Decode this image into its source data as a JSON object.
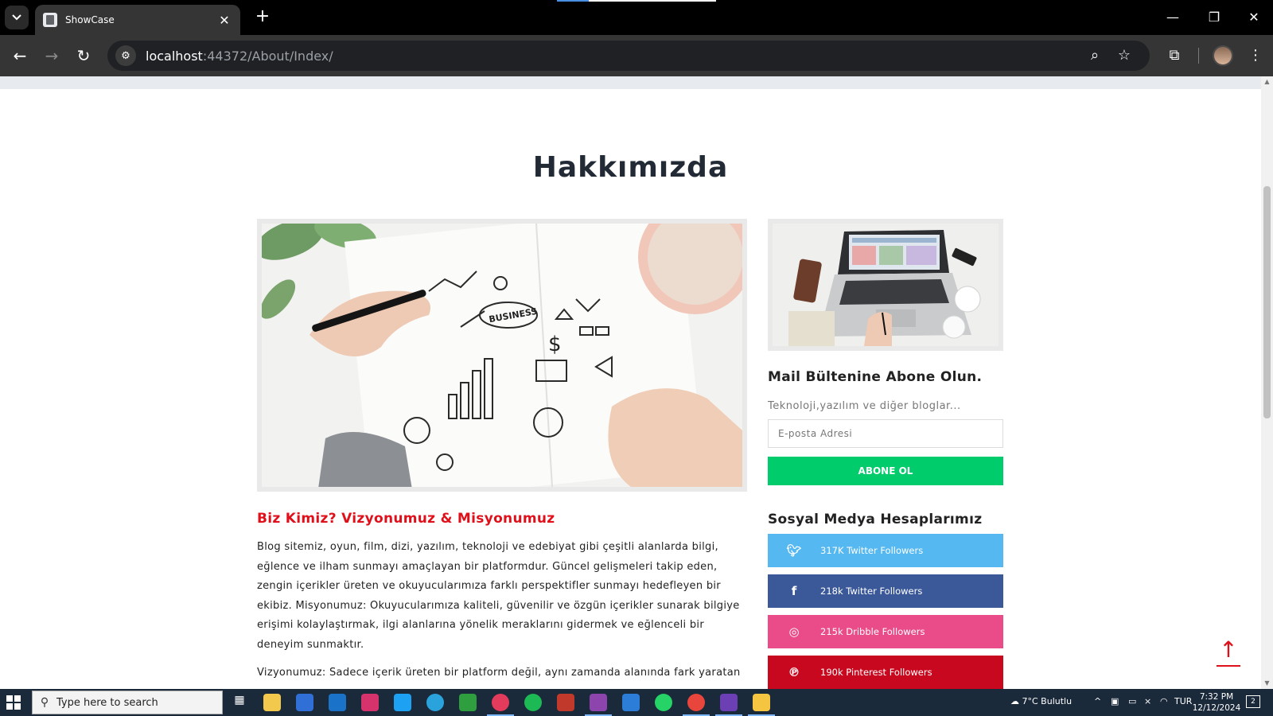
{
  "browser": {
    "tab_title": "ShowCase",
    "url_host": "localhost",
    "url_rest": ":44372/About/Index/"
  },
  "page": {
    "title": "Hakkımızda",
    "section_heading": "Biz Kimiz? Vizyonumuz & Misyonumuz",
    "paragraph_1": "Blog sitemiz, oyun, film, dizi, yazılım, teknoloji ve edebiyat gibi çeşitli alanlarda bilgi, eğlence ve ilham sunmayı amaçlayan bir platformdur. Güncel gelişmeleri takip eden, zengin içerikler üreten ve okuyucularımıza farklı perspektifler sunmayı hedefleyen bir ekibiz. Misyonumuz: Okuyucularımıza kaliteli, güvenilir ve özgün içerikler sunarak bilgiye erişimi kolaylaştırmak, ilgi alanlarına yönelik meraklarını gidermek ve eğlenceli bir deneyim sunmaktır.",
    "paragraph_2": "Vizyonumuz: Sadece içerik üreten bir platform değil, aynı zamanda alanında fark yaratan",
    "hero_sketch_label": "BUSINESS"
  },
  "sidebar": {
    "newsletter_heading": "Mail Bültenine Abone Olun.",
    "newsletter_sub": "Teknoloji,yazılım ve diğer bloglar...",
    "email_placeholder": "E-posta Adresi",
    "subscribe_label": "ABONE OL",
    "social_heading": "Sosyal Medya Hesaplarımız",
    "social": [
      {
        "icon": "twitter-icon",
        "label": "317K Twitter Followers",
        "color": "#55b8f0"
      },
      {
        "icon": "facebook-icon",
        "label": "218k Twitter Followers",
        "color": "#3b5999"
      },
      {
        "icon": "dribbble-icon",
        "label": "215k Dribble Followers",
        "color": "#e94c89"
      },
      {
        "icon": "pinterest-icon",
        "label": "190k Pinterest Followers",
        "color": "#c8081e"
      }
    ]
  },
  "taskbar": {
    "search_placeholder": "Type here to search",
    "weather": "7°C  Bulutlu",
    "language": "TUR",
    "time": "7:32 PM",
    "date": "12/12/2024",
    "notification_count": "2"
  },
  "colors": {
    "accent_red": "#e0101b",
    "subscribe_green": "#00cc6c"
  }
}
